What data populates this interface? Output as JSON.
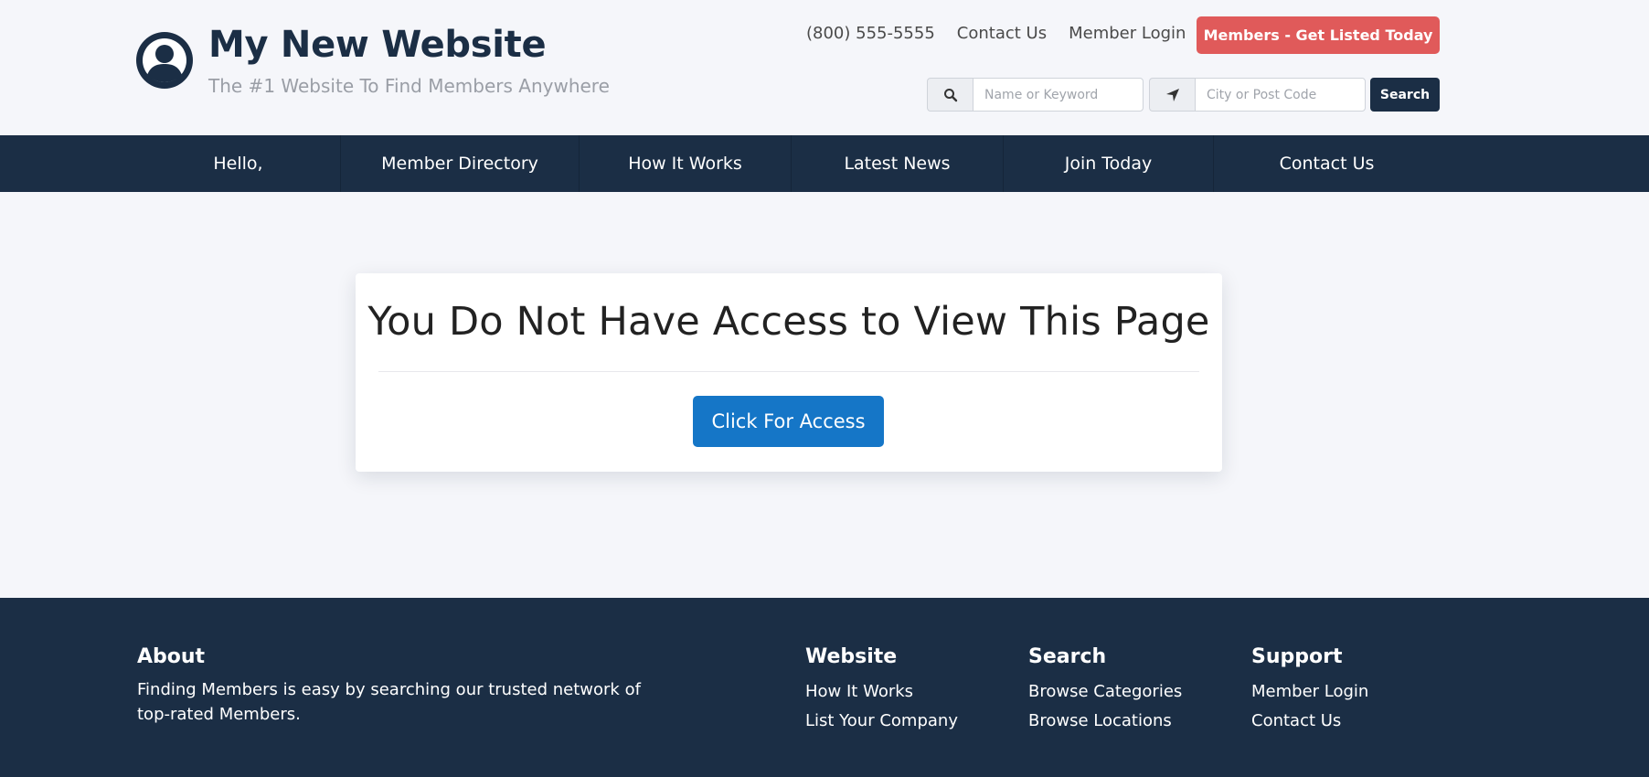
{
  "header": {
    "site_title": "My New Website",
    "tagline": "The #1 Website To Find Members Anywhere",
    "phone": "(800) 555-5555",
    "contact_link": "Contact Us",
    "login_link": "Member Login",
    "cta_label": "Members - Get Listed Today",
    "cta_color": "#e05a5a",
    "search": {
      "keyword_icon": "search-icon",
      "keyword_placeholder": "Name or Keyword",
      "keyword_value": "",
      "location_icon": "location-arrow-icon",
      "location_placeholder": "City or Post Code",
      "location_value": "",
      "button_label": "Search"
    }
  },
  "nav": {
    "items": [
      {
        "label": "Hello,"
      },
      {
        "label": "Member Directory"
      },
      {
        "label": "How It Works"
      },
      {
        "label": "Latest News"
      },
      {
        "label": "Join Today"
      },
      {
        "label": "Contact Us"
      }
    ],
    "color": "#1b2e45"
  },
  "main": {
    "heading": "You Do Not Have Access to View This Page",
    "button_label": "Click For Access",
    "button_color": "#1576c7"
  },
  "footer": {
    "about": {
      "title": "About",
      "text": "Finding Members is easy by searching our trusted network of top-rated Members."
    },
    "website": {
      "title": "Website",
      "links": [
        "How It Works",
        "List Your Company"
      ]
    },
    "search": {
      "title": "Search",
      "links": [
        "Browse Categories",
        "Browse Locations"
      ]
    },
    "support": {
      "title": "Support",
      "links": [
        "Member Login",
        "Contact Us"
      ]
    }
  }
}
